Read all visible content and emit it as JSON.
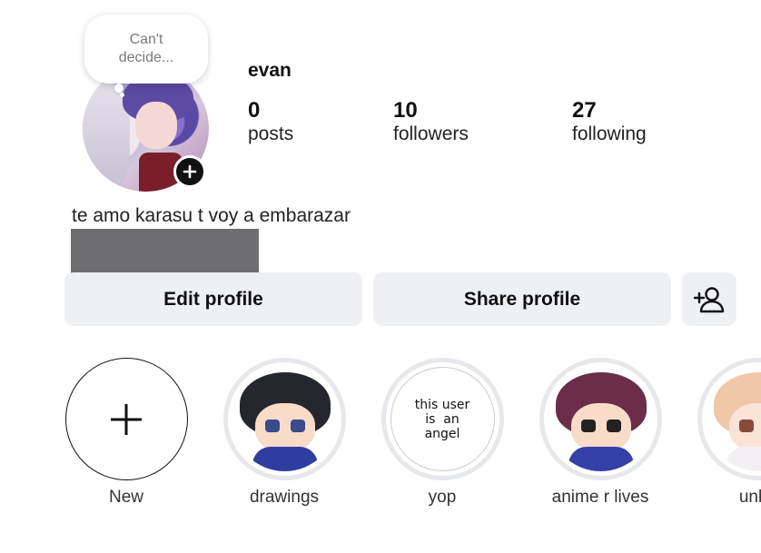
{
  "note": {
    "text_line1": "Can't",
    "text_line2": "decide..."
  },
  "profile": {
    "username": "evan",
    "stats": [
      {
        "value": "0",
        "label": "posts"
      },
      {
        "value": "10",
        "label": "followers"
      },
      {
        "value": "27",
        "label": "following"
      }
    ],
    "bio": "te amo karasu t voy a embarazar"
  },
  "buttons": {
    "edit": "Edit profile",
    "share": "Share profile",
    "add_person_icon": "add-person-icon"
  },
  "highlights": [
    {
      "label": "New",
      "icon": "plus-icon"
    },
    {
      "label": "drawings"
    },
    {
      "label": "yop",
      "text_lines": [
        "this user",
        "is  an",
        "angel"
      ]
    },
    {
      "label": "anime r lives"
    },
    {
      "label": "unbo"
    }
  ],
  "colors": {
    "button_bg": "#eff0f3",
    "ring": "#e6e8ec",
    "redaction": "#6e6e70"
  }
}
